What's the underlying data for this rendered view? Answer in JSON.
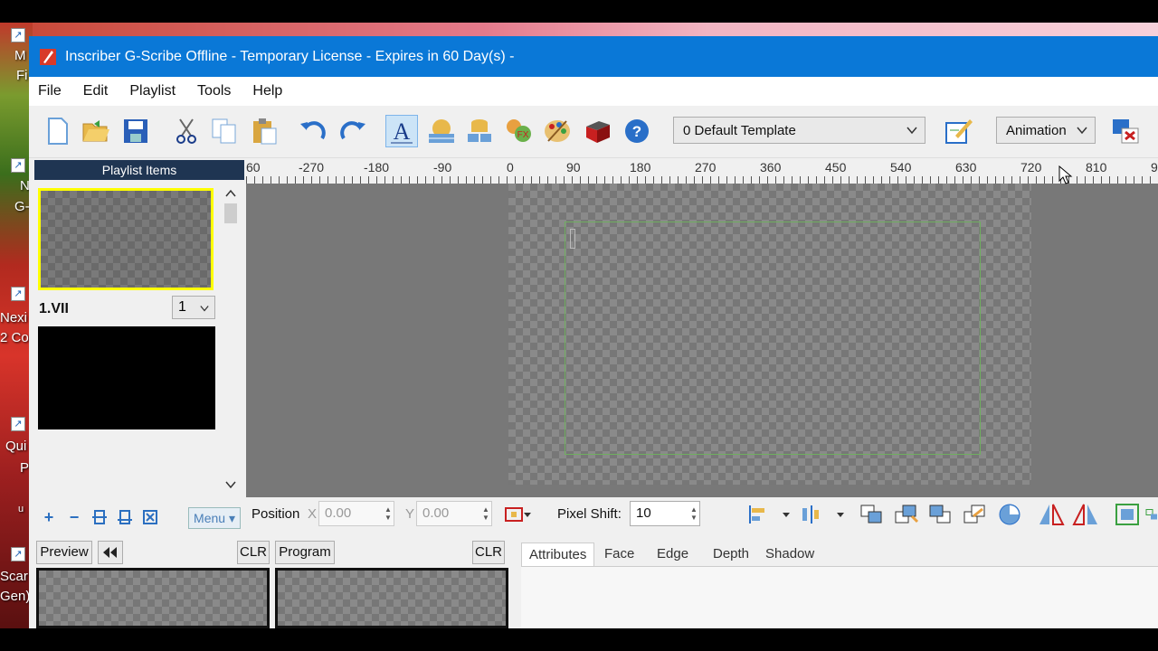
{
  "window": {
    "title": "Inscriber G-Scribe Offline - Temporary License - Expires in 60 Day(s) -"
  },
  "desktop": {
    "labels": [
      "M",
      "Fi",
      "N",
      "G-",
      "Nexi",
      "2 Cor",
      "Qui",
      "P",
      "u",
      "Scar",
      "Gen)"
    ]
  },
  "menubar": {
    "items": [
      "File",
      "Edit",
      "Playlist",
      "Tools",
      "Help"
    ]
  },
  "toolbar": {
    "template_dropdown": "0 Default Template",
    "mode_dropdown": "Animation"
  },
  "playlist": {
    "header": "Playlist Items",
    "item_label": "1.VII",
    "item_number": "1",
    "menu_button": "Menu ▾"
  },
  "ruler": {
    "labels": [
      "60",
      "-270",
      "-180",
      "-90",
      "0",
      "90",
      "180",
      "270",
      "360",
      "450",
      "540",
      "630",
      "720",
      "810",
      "9"
    ]
  },
  "position_bar": {
    "position_label": "Position",
    "x_label": "X",
    "x_value": "0.00",
    "y_label": "Y",
    "y_value": "0.00",
    "pixel_shift_label": "Pixel Shift:",
    "pixel_shift_value": "10"
  },
  "preview": {
    "preview_label": "Preview",
    "clr_label": "CLR",
    "program_label": "Program",
    "program_clr_label": "CLR"
  },
  "attributes": {
    "tabs": [
      "Attributes",
      "Face",
      "Edge",
      "Depth",
      "Shadow"
    ],
    "selected": "Attributes"
  },
  "colors": {
    "titlebar": "#0a78d7",
    "playlist_header": "#1f3552",
    "selection_border": "#ffff00",
    "safe_area": "#6fae5f"
  }
}
